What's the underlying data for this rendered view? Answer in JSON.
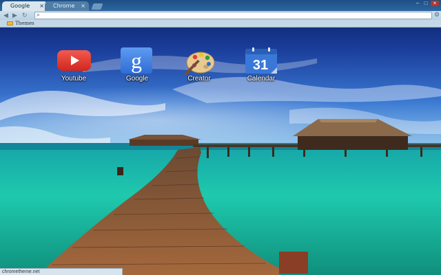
{
  "tabs": [
    {
      "label": "Google",
      "close": "×"
    },
    {
      "label": "Chrome",
      "close": "×"
    }
  ],
  "window_controls": {
    "minimize": "–",
    "maximize": "□",
    "close": "×"
  },
  "toolbar": {
    "back_icon": "◀",
    "forward_icon": "▶",
    "reload_icon": "↻",
    "search_icon": "⌕",
    "address_value": "",
    "wrench_icon": "⚙"
  },
  "bookmarks": [
    {
      "label": "Themes"
    }
  ],
  "apps": [
    {
      "label": "Youtube",
      "icon": "youtube-icon"
    },
    {
      "label": "Google",
      "icon": "google-icon",
      "glyph": "g"
    },
    {
      "label": "Creator",
      "icon": "palette-icon"
    },
    {
      "label": "Calendar",
      "icon": "calendar-icon",
      "glyph": "31"
    }
  ],
  "status": {
    "text": "chrometheme.net"
  },
  "colors": {
    "sky_top": "#0a1f66",
    "sky_mid": "#2f66c8",
    "sea": "#22c9b0",
    "boardwalk": "#8a5a36",
    "youtube_red": "#e0352b",
    "google_blue": "#3b7be0",
    "calendar_blue": "#3a78d8"
  }
}
